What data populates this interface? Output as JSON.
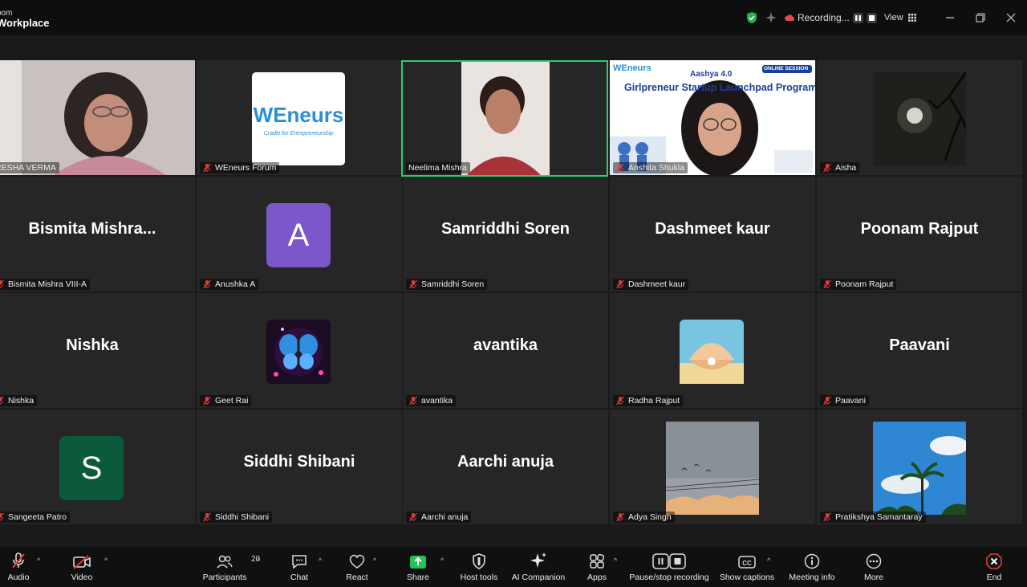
{
  "app": {
    "brand_top": "oom",
    "brand_bottom": "Workplace"
  },
  "titlebar": {
    "recording_label": "Recording...",
    "view_label": "View"
  },
  "participants_row1": [
    {
      "name": "RESHA VERMA"
    },
    {
      "name": "WEneurs Forum",
      "logo_main": "WEneurs",
      "logo_sub": "Cradle for Entrepreneurship"
    },
    {
      "name": "Neelima Mishra"
    },
    {
      "name": "Anshita Shukla",
      "banner_tag": "ONLINE SESSION",
      "banner_title": "Girlpreneur Startup Launchpad Program",
      "banner_brand": "Aashya 4.0",
      "banner_logo": "WEneurs"
    },
    {
      "name": "Aisha"
    }
  ],
  "participants": [
    {
      "display": "Bismita  Mishra...",
      "name": "Bismita Mishra VIII-A"
    },
    {
      "display": "A",
      "name": "Anushka A"
    },
    {
      "display": "Samriddhi Soren",
      "name": "Samriddhi Soren"
    },
    {
      "display": "Dashmeet kaur",
      "name": "Dashmeet kaur"
    },
    {
      "display": "Poonam Rajput",
      "name": "Poonam Rajput"
    },
    {
      "display": "Nishka",
      "name": "Nishka"
    },
    {
      "display": "",
      "name": "Geet Rai"
    },
    {
      "display": "avantika",
      "name": "avantika"
    },
    {
      "display": "",
      "name": "Radha Rajput"
    },
    {
      "display": "Paavani",
      "name": "Paavani"
    },
    {
      "display": "S",
      "name": "Sangeeta Patro"
    },
    {
      "display": "Siddhi Shibani",
      "name": "Siddhi Shibani"
    },
    {
      "display": "Aarchi anuja",
      "name": "Aarchi anuja"
    },
    {
      "display": "",
      "name": "Adya Singh"
    },
    {
      "display": "",
      "name": "Pratikshya Samantaray"
    }
  ],
  "toolbar": {
    "audio": "Audio",
    "video": "Video",
    "participants": "Participants",
    "participants_count": "20",
    "chat": "Chat",
    "react": "React",
    "share": "Share",
    "host_tools": "Host tools",
    "ai_companion": "AI Companion",
    "apps": "Apps",
    "pause_recording": "Pause/stop recording",
    "captions": "Show captions",
    "meeting_info": "Meeting info",
    "more": "More",
    "end": "End"
  },
  "colors": {
    "active_speaker": "#2ecc71",
    "muted": "#e03c3c",
    "share": "#21c35a",
    "avatar_a": "#7b57c9",
    "avatar_s": "#0b5a3c"
  }
}
